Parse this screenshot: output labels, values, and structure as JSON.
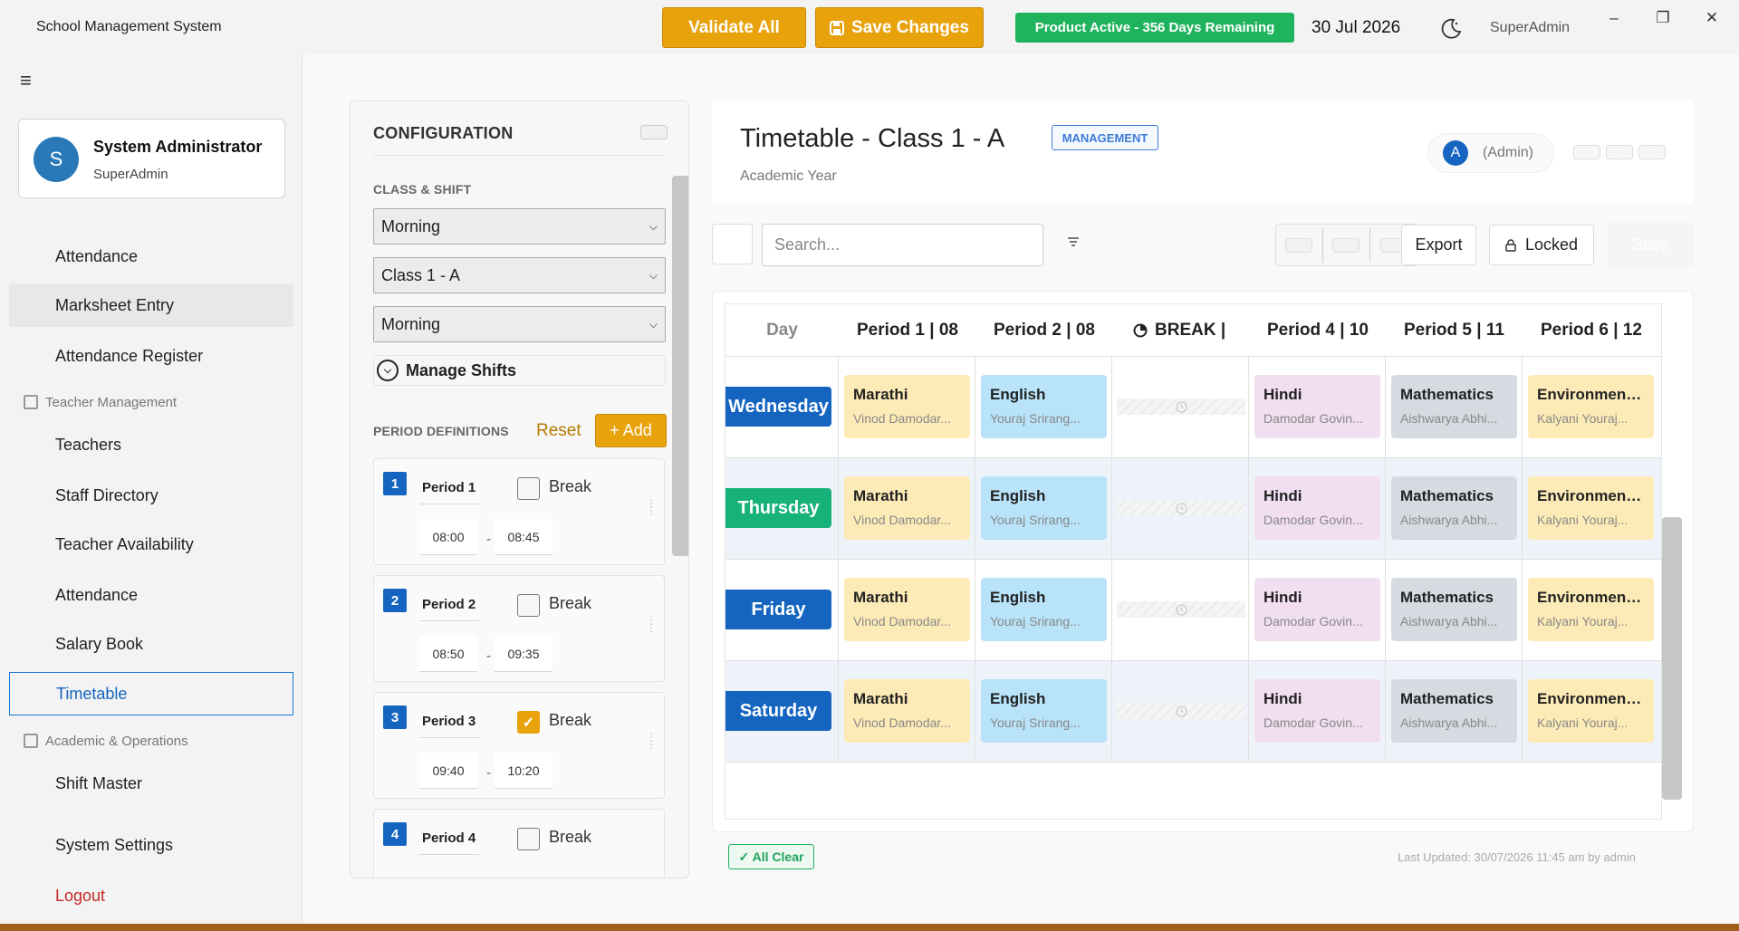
{
  "titlebar": {
    "app_title": "School Management System",
    "validate_label": "Validate All",
    "save_changes_label": "Save Changes",
    "product_status": "Product Active - 356 Days Remaining",
    "date": "30 Jul 2026",
    "user_role": "SuperAdmin",
    "colors": {
      "amber": "#e8a20c",
      "green": "#20b35e"
    }
  },
  "profile": {
    "initial": "S",
    "name": "System Administrator",
    "role": "SuperAdmin"
  },
  "sidebar": {
    "items": [
      {
        "label": "Attendance"
      },
      {
        "label": "Marksheet Entry"
      },
      {
        "label": "Attendance Register"
      },
      {
        "label": "Teachers"
      },
      {
        "label": "Staff Directory"
      },
      {
        "label": "Teacher Availability"
      },
      {
        "label": "Attendance"
      },
      {
        "label": "Salary Book"
      },
      {
        "label": "Timetable"
      },
      {
        "label": "Shift Master"
      },
      {
        "label": "System Settings"
      },
      {
        "label": "Logout"
      }
    ],
    "sections": [
      {
        "label": "Teacher Management"
      },
      {
        "label": "Academic & Operations"
      }
    ],
    "active_item": "Timetable"
  },
  "config": {
    "title": "CONFIGURATION",
    "class_shift_label": "CLASS & SHIFT",
    "shift_select": "Morning",
    "class_select": "Class 1 - A",
    "shift_select_2": "Morning",
    "manage_shifts": "Manage Shifts",
    "period_definitions_label": "PERIOD DEFINITIONS",
    "reset_label": "Reset",
    "add_label": "+ Add",
    "break_label": "Break",
    "periods": [
      {
        "num": "1",
        "name": "Period 1",
        "is_break": false,
        "start": "08:00",
        "end": "08:45"
      },
      {
        "num": "2",
        "name": "Period 2",
        "is_break": false,
        "start": "08:50",
        "end": "09:35"
      },
      {
        "num": "3",
        "name": "Period 3",
        "is_break": true,
        "start": "09:40",
        "end": "10:20"
      },
      {
        "num": "4",
        "name": "Period 4",
        "is_break": false,
        "start": "",
        "end": ""
      }
    ]
  },
  "timetable": {
    "title": "Timetable - Class 1 - A",
    "badge": "MANAGEMENT",
    "academic_year": "Academic Year",
    "admin_initial": "A",
    "admin_label": "(Admin)",
    "search_placeholder": "Search...",
    "export_label": "Export",
    "locked_label": "Locked",
    "save_label": "Save",
    "headers": [
      "Day",
      "Period 1 | 08",
      "Period 2 | 08",
      "BREAK |",
      "Period 4 | 10",
      "Period 5 | 11",
      "Period 6 | 12"
    ],
    "rows": [
      {
        "day": "Wednesday",
        "day_color": "#1565c0",
        "cells": [
          {
            "subject": "Marathi",
            "teacher": "Vinod Damodar...",
            "color": "#fdebb7"
          },
          {
            "subject": "English",
            "teacher": "Youraj Srirang...",
            "color": "#b8e3f8"
          },
          {
            "break": true
          },
          {
            "subject": "Hindi",
            "teacher": "Damodar Govin...",
            "color": "#f1def0"
          },
          {
            "subject": "Mathematics",
            "teacher": "Aishwarya   Abhi...",
            "color": "#d5dbe0"
          },
          {
            "subject": "Environmenta...",
            "teacher": "Kalyani Youraj...",
            "color": "#fdebb7"
          }
        ]
      },
      {
        "day": "Thursday",
        "day_color": "#17b27a",
        "cells": [
          {
            "subject": "Marathi",
            "teacher": "Vinod Damodar...",
            "color": "#fdebb7"
          },
          {
            "subject": "English",
            "teacher": "Youraj Srirang...",
            "color": "#b8e3f8"
          },
          {
            "break": true
          },
          {
            "subject": "Hindi",
            "teacher": "Damodar Govin...",
            "color": "#f1def0"
          },
          {
            "subject": "Mathematics",
            "teacher": "Aishwarya   Abhi...",
            "color": "#d5dbe0"
          },
          {
            "subject": "Environmenta...",
            "teacher": "Kalyani Youraj...",
            "color": "#fdebb7"
          }
        ]
      },
      {
        "day": "Friday",
        "day_color": "#1565c0",
        "cells": [
          {
            "subject": "Marathi",
            "teacher": "Vinod Damodar...",
            "color": "#fdebb7"
          },
          {
            "subject": "English",
            "teacher": "Youraj Srirang...",
            "color": "#b8e3f8"
          },
          {
            "break": true
          },
          {
            "subject": "Hindi",
            "teacher": "Damodar Govin...",
            "color": "#f1def0"
          },
          {
            "subject": "Mathematics",
            "teacher": "Aishwarya   Abhi...",
            "color": "#d5dbe0"
          },
          {
            "subject": "Environmenta...",
            "teacher": "Kalyani Youraj...",
            "color": "#fdebb7"
          }
        ]
      },
      {
        "day": "Saturday",
        "day_color": "#1565c0",
        "cells": [
          {
            "subject": "Marathi",
            "teacher": "Vinod Damodar...",
            "color": "#fdebb7"
          },
          {
            "subject": "English",
            "teacher": "Youraj Srirang...",
            "color": "#b8e3f8"
          },
          {
            "break": true
          },
          {
            "subject": "Hindi",
            "teacher": "Damodar Govin...",
            "color": "#f1def0"
          },
          {
            "subject": "Mathematics",
            "teacher": "Aishwarya   Abhi...",
            "color": "#d5dbe0"
          },
          {
            "subject": "Environmenta...",
            "teacher": "Kalyani Youraj...",
            "color": "#fdebb7"
          }
        ]
      }
    ],
    "status": "✓ All Clear",
    "last_updated": "Last Updated: 30/07/2026 11:45 am by admin"
  }
}
